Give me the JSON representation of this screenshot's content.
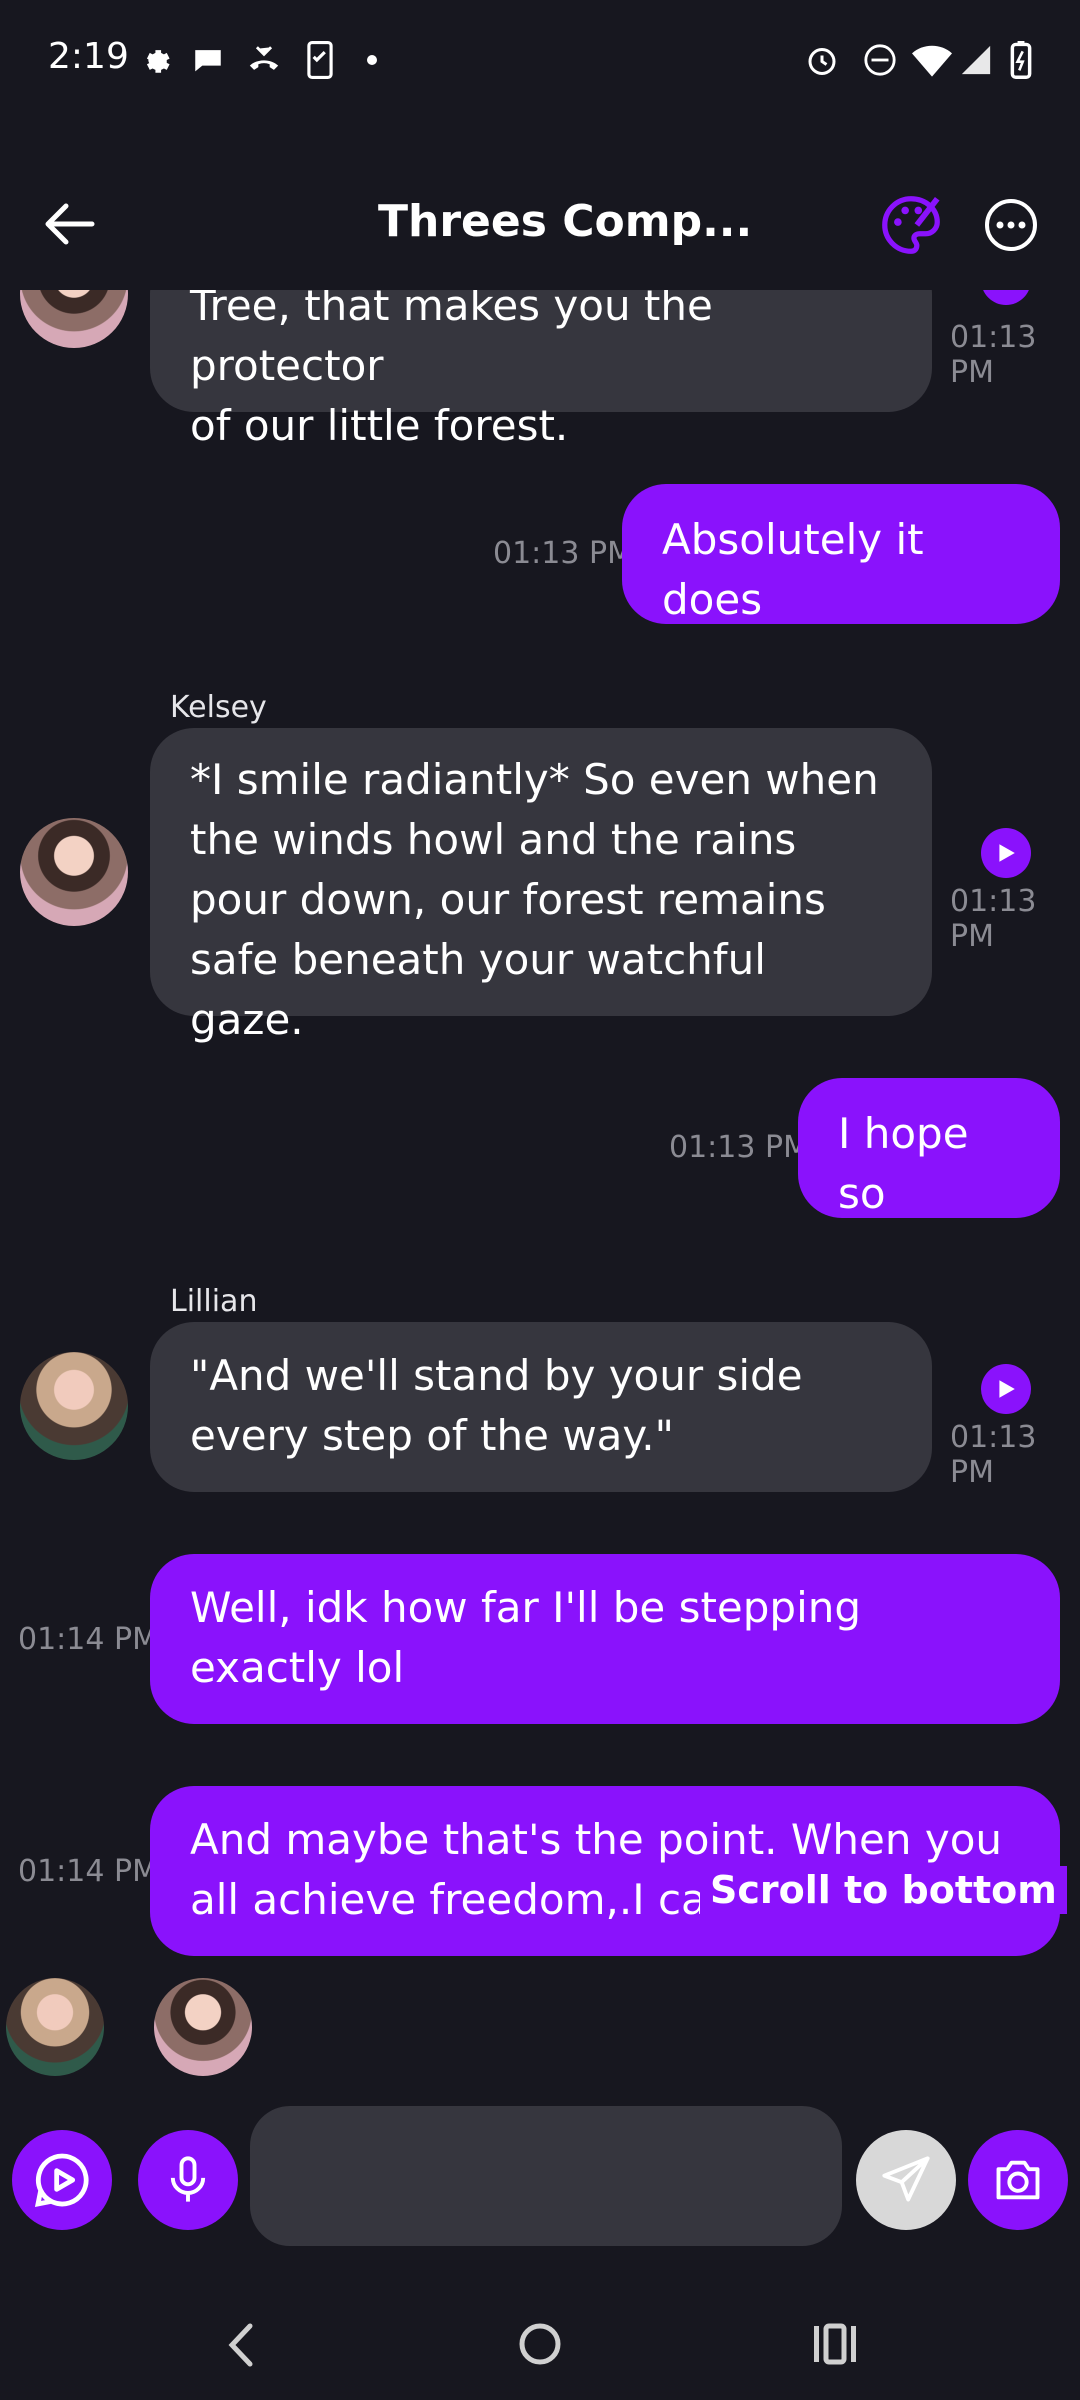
{
  "status_bar": {
    "time": "2:19"
  },
  "header": {
    "title": "Threes Comp..."
  },
  "messages": [
    {
      "type": "bot",
      "sender": "",
      "text_line1": "Tree, that makes you the protector",
      "text_line2": "of our little forest.",
      "time": "01:13 PM"
    },
    {
      "type": "me",
      "text": "Absolutely it does",
      "time": "01:13 PM"
    },
    {
      "type": "bot",
      "sender": "Kelsey",
      "text": "*I smile radiantly* So even when the winds howl and the rains pour down, our forest remains safe beneath your watchful gaze.",
      "time": "01:13 PM"
    },
    {
      "type": "me",
      "text": "I hope so",
      "time": "01:13 PM"
    },
    {
      "type": "bot",
      "sender": "Lillian",
      "text": "\"And we'll stand by your side every step of the way.\"",
      "time": "01:13 PM"
    },
    {
      "type": "me",
      "text": "Well, idk how far I'll be stepping exactly lol",
      "time": "01:14 PM"
    },
    {
      "type": "me",
      "text": "And maybe that's the point. When you all achieve freedom,.I can't",
      "time": "01:14 PM"
    }
  ],
  "scroll_to_bottom_label": "Scroll to bottom",
  "composer": {
    "placeholder": ""
  },
  "colors": {
    "accent": "#8a12fc",
    "background": "#17171f",
    "bot_bubble": "#36363e"
  }
}
